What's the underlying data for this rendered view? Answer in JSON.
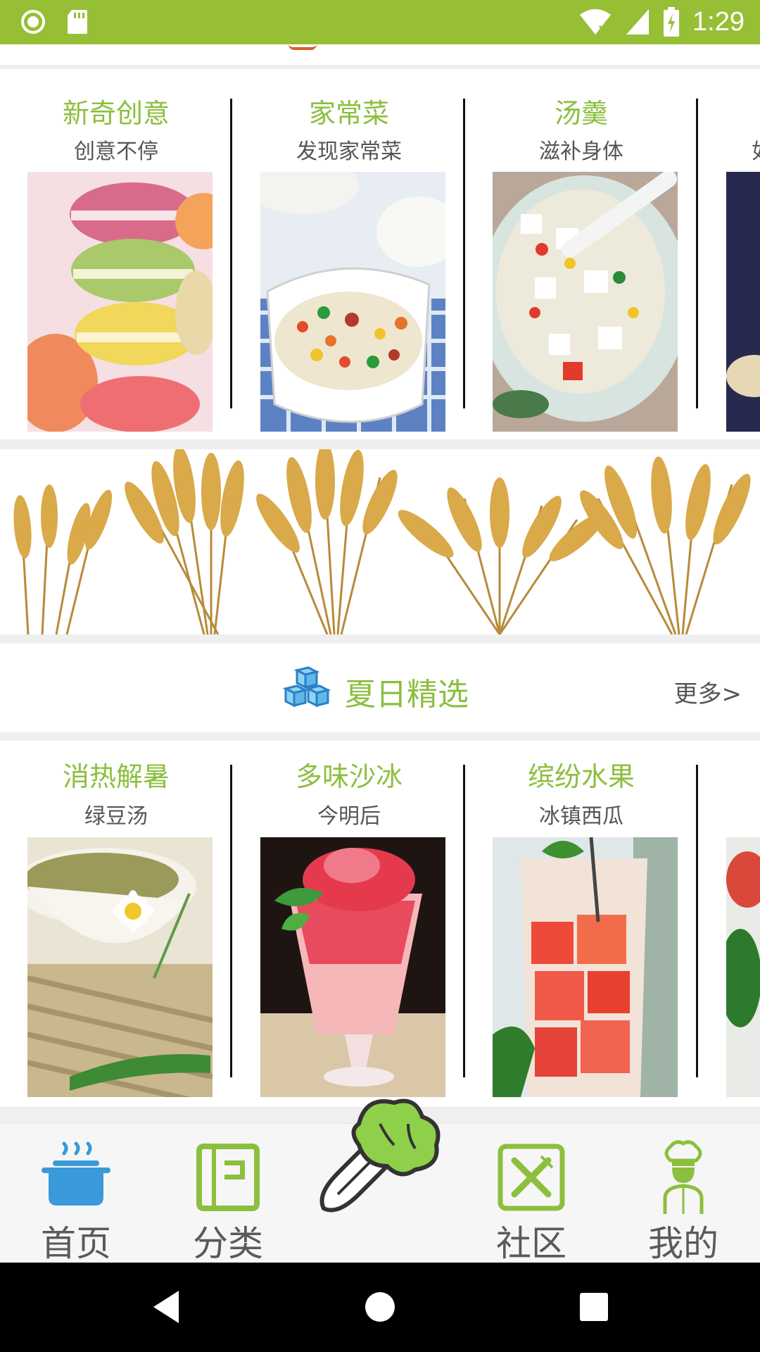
{
  "status_bar": {
    "time": "1:29",
    "bg_color": "#97bf36",
    "left_icons": [
      "record-icon",
      "sd-card-icon"
    ],
    "right_icons": [
      "wifi-off-icon",
      "signal-icon",
      "battery-charging-icon"
    ]
  },
  "row1": {
    "cards": [
      {
        "title": "新奇创意",
        "subtitle": "创意不停",
        "image": "macarons-image"
      },
      {
        "title": "家常菜",
        "subtitle": "发现家常菜",
        "image": "fried-rice-image"
      },
      {
        "title": "汤羹",
        "subtitle": "滋补身体",
        "image": "tofu-soup-image"
      },
      {
        "title": "",
        "subtitle": "如",
        "image": "partial-dish-image"
      }
    ]
  },
  "banner": {
    "image": "wheat-banner-image"
  },
  "section": {
    "title": "夏日精选",
    "more": "更多>",
    "icon": "ice-cubes-icon"
  },
  "row2": {
    "cards": [
      {
        "title": "消热解暑",
        "subtitle": "绿豆汤",
        "image": "mung-bean-soup-image"
      },
      {
        "title": "多味沙冰",
        "subtitle": "今明后",
        "image": "shaved-ice-image"
      },
      {
        "title": "缤纷水果",
        "subtitle": "冰镇西瓜",
        "image": "watermelon-drink-image"
      },
      {
        "title": "",
        "subtitle": "",
        "image": "partial-fruit-image"
      }
    ]
  },
  "bottom_nav": {
    "items": [
      {
        "label": "首页",
        "icon": "pot-icon",
        "active": true
      },
      {
        "label": "分类",
        "icon": "notebook-icon",
        "active": false
      },
      {
        "label": "",
        "icon": "cabbage-icon",
        "active": false
      },
      {
        "label": "社区",
        "icon": "fork-knife-icon",
        "active": false
      },
      {
        "label": "我的",
        "icon": "chef-icon",
        "active": false
      }
    ]
  },
  "colors": {
    "accent": "#8cbf3e",
    "nav_blue": "#3a9ad9"
  }
}
